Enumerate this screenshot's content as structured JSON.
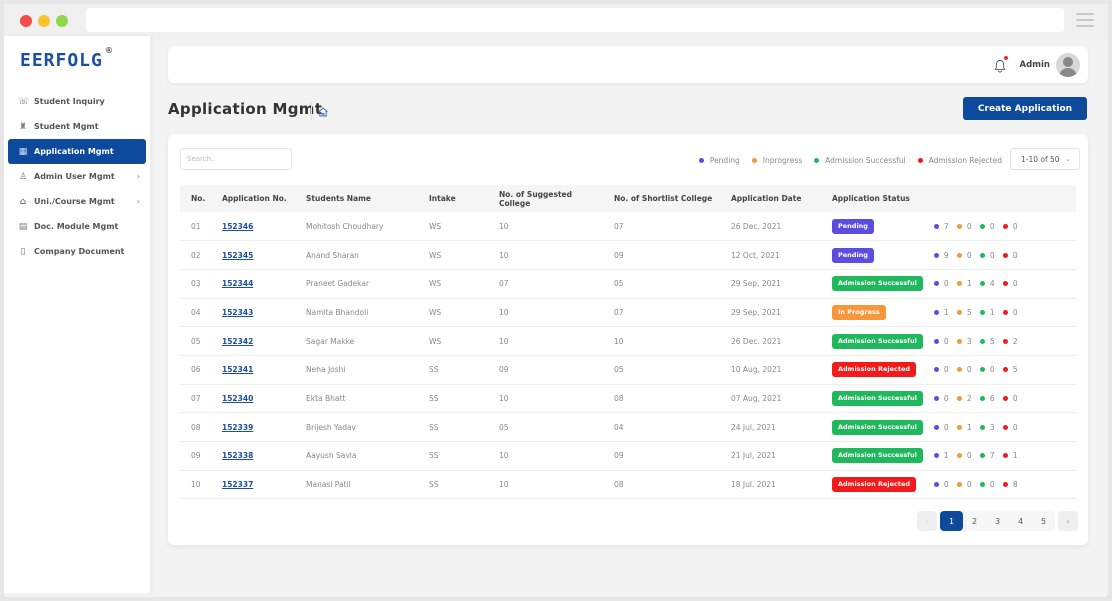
{
  "brand": {
    "name": "EERFOLG",
    "registered_mark": "®"
  },
  "sidebar": {
    "items": [
      {
        "label": "Student Inquiry",
        "icon": "chat-question-icon",
        "glyph": "☏",
        "active": false,
        "has_submenu": false
      },
      {
        "label": "Student Mgmt",
        "icon": "student-icon",
        "glyph": "♜",
        "active": false,
        "has_submenu": false
      },
      {
        "label": "Application Mgmt",
        "icon": "application-icon",
        "glyph": "▦",
        "active": true,
        "has_submenu": false
      },
      {
        "label": "Admin User Mgmt",
        "icon": "user-icon",
        "glyph": "♙",
        "active": false,
        "has_submenu": true
      },
      {
        "label": "Uni./Course Mgmt",
        "icon": "university-icon",
        "glyph": "⌂",
        "active": false,
        "has_submenu": true
      },
      {
        "label": "Doc. Module Mgmt",
        "icon": "document-settings-icon",
        "glyph": "▤",
        "active": false,
        "has_submenu": false
      },
      {
        "label": "Company Document",
        "icon": "document-icon",
        "glyph": "▯",
        "active": false,
        "has_submenu": false
      }
    ],
    "submenu_glyph": "›"
  },
  "topbar": {
    "user_name": "Admin",
    "has_notification": true
  },
  "page": {
    "title": "Application Mgmt",
    "create_button_label": "Create Application"
  },
  "filters": {
    "search_placeholder": "Search..",
    "per_page_label": "1-10 of 50",
    "legend": [
      {
        "label": "Pending",
        "color": "#5b4de0"
      },
      {
        "label": "Inprogress",
        "color": "#f7973a"
      },
      {
        "label": "Admission Successful",
        "color": "#1fb85c"
      },
      {
        "label": "Admission Rejected",
        "color": "#f21a1a"
      }
    ]
  },
  "status_colors": {
    "Pending": "#5b4de0",
    "In Progress": "#f7973a",
    "Admission Successful": "#1fb85c",
    "Admission Rejected": "#f21a1a"
  },
  "table": {
    "columns": [
      "No.",
      "Application No.",
      "Students Name",
      "Intake",
      "No. of Suggested College",
      "No. of Shortlist College",
      "Application Date",
      "Application Status"
    ],
    "rows": [
      {
        "no": "01",
        "app_no": "152346",
        "name": "Mohitosh Choudhary",
        "intake": "WS",
        "suggested": "10",
        "shortlist": "07",
        "date": "26 Dec. 2021",
        "status": "Pending",
        "counts": [
          7,
          0,
          0,
          0
        ]
      },
      {
        "no": "02",
        "app_no": "152345",
        "name": "Anand Sharan",
        "intake": "WS",
        "suggested": "10",
        "shortlist": "09",
        "date": "12 Oct, 2021",
        "status": "Pending",
        "counts": [
          9,
          0,
          0,
          0
        ]
      },
      {
        "no": "03",
        "app_no": "152344",
        "name": "Praneet Gadekar",
        "intake": "WS",
        "suggested": "07",
        "shortlist": "05",
        "date": "29 Sep, 2021",
        "status": "Admission Successful",
        "counts": [
          0,
          1,
          4,
          0
        ]
      },
      {
        "no": "04",
        "app_no": "152343",
        "name": "Namita Bhandoli",
        "intake": "WS",
        "suggested": "10",
        "shortlist": "07",
        "date": "29 Sep, 2021",
        "status": "In Progress",
        "counts": [
          1,
          5,
          1,
          0
        ]
      },
      {
        "no": "05",
        "app_no": "152342",
        "name": "Sagar Makke",
        "intake": "WS",
        "suggested": "10",
        "shortlist": "10",
        "date": "26 Dec. 2021",
        "status": "Admission Successful",
        "counts": [
          0,
          3,
          5,
          2
        ]
      },
      {
        "no": "06",
        "app_no": "152341",
        "name": "Neha Joshi",
        "intake": "SS",
        "suggested": "09",
        "shortlist": "05",
        "date": "10 Aug, 2021",
        "status": "Admission Rejected",
        "counts": [
          0,
          0,
          0,
          5
        ]
      },
      {
        "no": "07",
        "app_no": "152340",
        "name": "Ekta Bhatt",
        "intake": "SS",
        "suggested": "10",
        "shortlist": "08",
        "date": "07 Aug, 2021",
        "status": "Admission Successful",
        "counts": [
          0,
          2,
          6,
          0
        ]
      },
      {
        "no": "08",
        "app_no": "152339",
        "name": "Brijesh Yadav",
        "intake": "SS",
        "suggested": "05",
        "shortlist": "04",
        "date": "24 Jul, 2021",
        "status": "Admission Successful",
        "counts": [
          0,
          1,
          3,
          0
        ]
      },
      {
        "no": "09",
        "app_no": "152338",
        "name": "Aayush Savla",
        "intake": "SS",
        "suggested": "10",
        "shortlist": "09",
        "date": "21 Jul, 2021",
        "status": "Admission Successful",
        "counts": [
          1,
          0,
          7,
          1
        ]
      },
      {
        "no": "10",
        "app_no": "152337",
        "name": "Manasi Patil",
        "intake": "SS",
        "suggested": "10",
        "shortlist": "08",
        "date": "18 Jul. 2021",
        "status": "Admission Rejected",
        "counts": [
          0,
          0,
          0,
          8
        ]
      }
    ]
  },
  "pagination": {
    "pages": [
      "1",
      "2",
      "3",
      "4",
      "5"
    ],
    "current": "1",
    "prev": "‹",
    "next": "›"
  }
}
